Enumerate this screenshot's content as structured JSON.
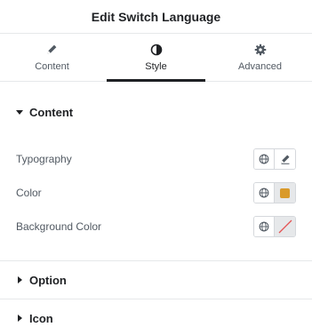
{
  "header": {
    "title": "Edit Switch Language"
  },
  "tabs": [
    {
      "label": "Content",
      "icon": "pencil-icon",
      "active": false
    },
    {
      "label": "Style",
      "icon": "contrast-icon",
      "active": true
    },
    {
      "label": "Advanced",
      "icon": "gear-icon",
      "active": false
    }
  ],
  "content_section": {
    "title": "Content",
    "rows": [
      {
        "label": "Typography",
        "action_icon": "pencil-icon"
      },
      {
        "label": "Color",
        "swatch": "#d99a2b"
      },
      {
        "label": "Background Color",
        "swatch": "none"
      }
    ]
  },
  "collapsed_sections": [
    {
      "title": "Option"
    },
    {
      "title": "Icon"
    }
  ],
  "colors": {
    "accent": "#1f2124",
    "swatch_color": "#d99a2b",
    "clear_slash": "#e55353"
  }
}
